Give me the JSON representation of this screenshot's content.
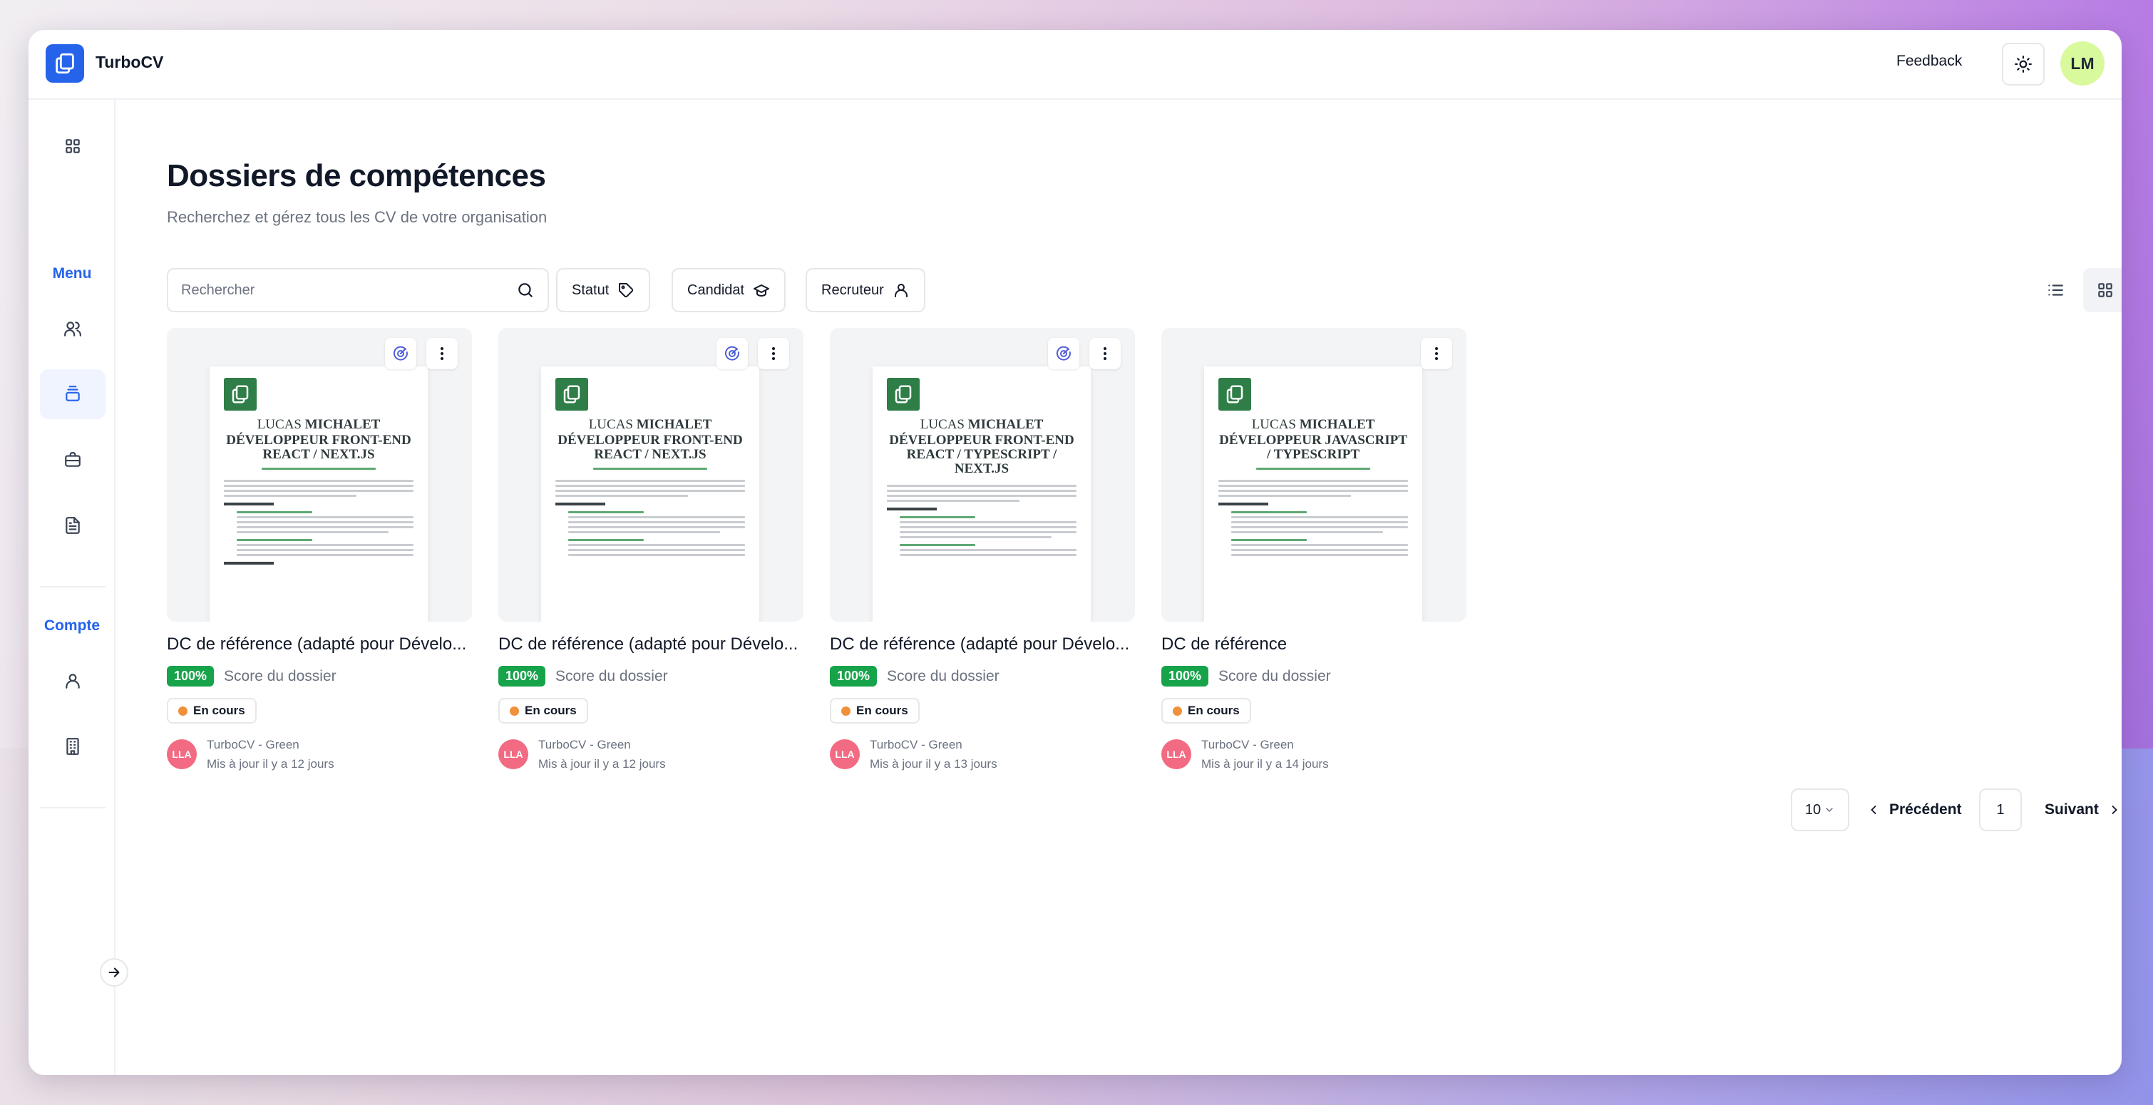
{
  "app": {
    "brand": "TurboCV"
  },
  "header": {
    "feedback_label": "Feedback",
    "theme_icon": "sun-icon",
    "user_initials": "LM",
    "avatar_color": "#d9f99d"
  },
  "sidebar": {
    "menu_label": "Menu",
    "account_label": "Compte",
    "items": [
      {
        "icon": "dashboard-icon",
        "active": false
      },
      {
        "icon": "users-icon",
        "active": false
      },
      {
        "icon": "layers-icon",
        "active": true
      },
      {
        "icon": "briefcase-icon",
        "active": false
      },
      {
        "icon": "document-icon",
        "active": false
      },
      {
        "icon": "user-icon",
        "active": false
      },
      {
        "icon": "building-icon",
        "active": false
      }
    ]
  },
  "page": {
    "title": "Dossiers de compétences",
    "subtitle": "Recherchez et gérez tous les CV de votre organisation"
  },
  "search": {
    "placeholder": "Rechercher",
    "value": ""
  },
  "filters": {
    "status": "Statut",
    "candidate": "Candidat",
    "recruiter": "Recruteur"
  },
  "cards": [
    {
      "title": "DC de référence (adapté pour Dévelo...",
      "doc_name_first": "LUCAS ",
      "doc_name_last": "MICHALET",
      "doc_role": "DÉVELOPPEUR FRONT-END REACT / NEXT.JS",
      "score": "100%",
      "score_label": "Score du dossier",
      "status": "En cours",
      "owner_initials": "LLA",
      "owner_org": "TurboCV - Green",
      "updated": "Mis à jour il y a 12 jours"
    },
    {
      "title": "DC de référence (adapté pour Dévelo...",
      "doc_name_first": "LUCAS ",
      "doc_name_last": "MICHALET",
      "doc_role": "DÉVELOPPEUR FRONT-END REACT / NEXT.JS",
      "score": "100%",
      "score_label": "Score du dossier",
      "status": "En cours",
      "owner_initials": "LLA",
      "owner_org": "TurboCV - Green",
      "updated": "Mis à jour il y a 12 jours"
    },
    {
      "title": "DC de référence (adapté pour Dévelo...",
      "doc_name_first": "LUCAS ",
      "doc_name_last": "MICHALET",
      "doc_role": "DÉVELOPPEUR FRONT-END REACT / TYPESCRIPT / NEXT.JS",
      "score": "100%",
      "score_label": "Score du dossier",
      "status": "En cours",
      "owner_initials": "LLA",
      "owner_org": "TurboCV - Green",
      "updated": "Mis à jour il y a 13 jours"
    },
    {
      "title": "DC de référence",
      "doc_name_first": "LUCAS ",
      "doc_name_last": "MICHALET",
      "doc_role": "DÉVELOPPEUR JAVASCRIPT / TYPESCRIPT",
      "score": "100%",
      "score_label": "Score du dossier",
      "status": "En cours",
      "owner_initials": "LLA",
      "owner_org": "TurboCV - Green",
      "updated": "Mis à jour il y a 14 jours"
    }
  ],
  "pagination": {
    "per_page": "10",
    "prev_label": "Précédent",
    "current_page": "1",
    "next_label": "Suivant"
  },
  "colors": {
    "primary": "#2563eb",
    "score_badge": "#16a34a",
    "status_dot": "#f0903a",
    "owner_avatar": "#f26b83"
  }
}
